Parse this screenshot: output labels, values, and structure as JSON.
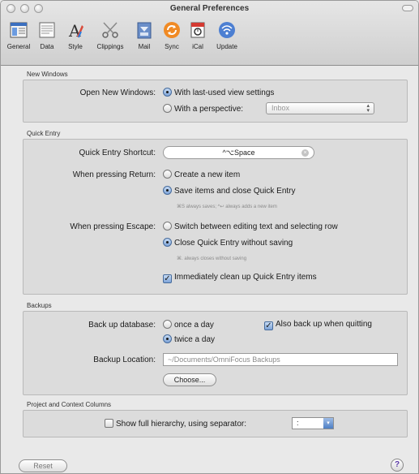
{
  "window": {
    "title": "General Preferences"
  },
  "toolbar": {
    "items": [
      {
        "label": "General",
        "icon": "general-icon"
      },
      {
        "label": "Data",
        "icon": "data-icon"
      },
      {
        "label": "Style",
        "icon": "style-icon"
      },
      {
        "label": "Clippings",
        "icon": "clippings-icon"
      },
      {
        "label": "Mail",
        "icon": "mail-icon"
      },
      {
        "label": "Sync",
        "icon": "sync-icon"
      },
      {
        "label": "iCal",
        "icon": "ical-icon"
      },
      {
        "label": "Update",
        "icon": "update-icon"
      }
    ],
    "selected": "General"
  },
  "new_windows": {
    "section_label": "New Windows",
    "label": "Open New Windows:",
    "option_last_used": "With last-used view settings",
    "option_perspective": "With a perspective:",
    "perspective_value": "Inbox",
    "selected": "last_used"
  },
  "quick_entry": {
    "section_label": "Quick Entry",
    "shortcut_label": "Quick Entry Shortcut:",
    "shortcut_value": "^⌥Space",
    "return_label": "When pressing Return:",
    "return_option_create": "Create a new item",
    "return_option_save": "Save items and close Quick Entry",
    "return_hint": "⌘S always saves; ^↩ always adds a new item",
    "return_selected": "save",
    "escape_label": "When pressing Escape:",
    "escape_option_switch": "Switch between editing text and selecting row",
    "escape_option_close": "Close Quick Entry without saving",
    "escape_hint": "⌘. always closes without saving",
    "escape_selected": "close",
    "cleanup_label": "Immediately clean up Quick Entry items",
    "cleanup_checked": true
  },
  "backups": {
    "section_label": "Backups",
    "backup_label": "Back up database:",
    "option_once": "once a day",
    "option_twice": "twice a day",
    "frequency_selected": "twice",
    "quit_label": "Also back up when quitting",
    "quit_checked": true,
    "location_label": "Backup Location:",
    "location_value": "~/Documents/OmniFocus Backups",
    "choose_button": "Choose..."
  },
  "columns": {
    "section_label": "Project and Context Columns",
    "hierarchy_label": "Show full hierarchy, using separator:",
    "hierarchy_checked": false,
    "separator_value": ":"
  },
  "footer": {
    "reset_button": "Reset",
    "help_label": "?"
  },
  "colors": {
    "accent": "#5b8fd6",
    "help_glyph": "#5c3ba8"
  }
}
